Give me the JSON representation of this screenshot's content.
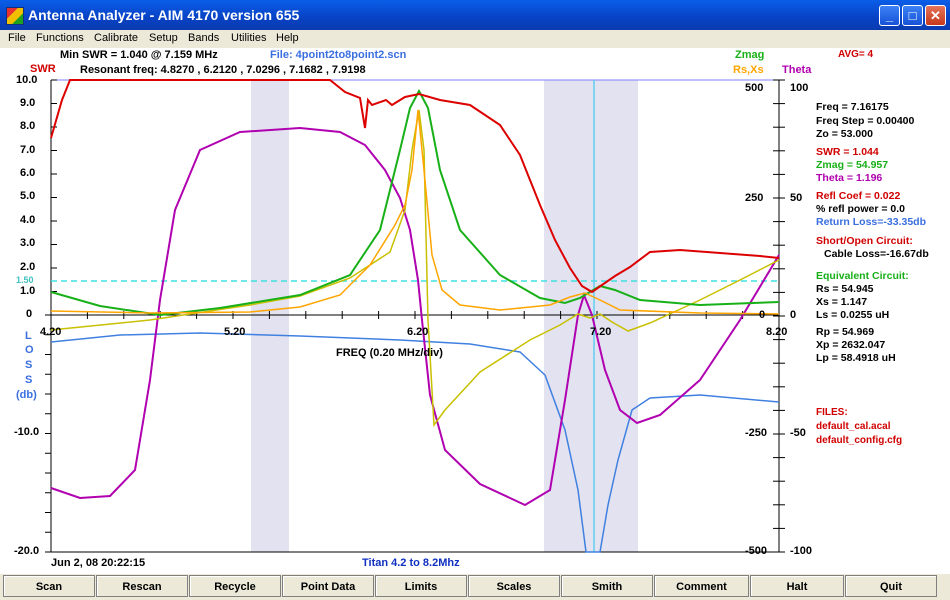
{
  "window": {
    "title": "Antenna Analyzer -   AIM 4170 version 655"
  },
  "menu": [
    "File",
    "Functions",
    "Calibrate",
    "Setup",
    "Bands",
    "Utilities",
    "Help"
  ],
  "header": {
    "min_swr": "Min SWR =  1.040 @  7.159 MHz",
    "file": "File: 4point2to8point2.scn",
    "resonant": "Resonant freq:  4.8270 , 6.2120 , 7.0296 , 7.1682 , 7.9198",
    "avg": "AVG=  4",
    "zmag_label": "Zmag",
    "rsxs_label": "Rs,Xs",
    "theta_label": "Theta",
    "swr_label": "SWR"
  },
  "axes": {
    "swr_ticks": [
      "10.0",
      "9.0",
      "8.0",
      "7.0",
      "6.0",
      "5.0",
      "4.0",
      "3.0",
      "2.0",
      "1.50",
      "1.0",
      "0"
    ],
    "x_ticks": [
      "4.20",
      "5.20",
      "6.20",
      "7.20",
      "8.20"
    ],
    "freq_label": "FREQ (0.20 MHz/div)",
    "loss_label": [
      "L",
      "O",
      "S",
      "S",
      "(db)"
    ],
    "loss_ticks": [
      "-10.0",
      "-20.0"
    ],
    "right1_ticks": [
      "500",
      "250",
      "0",
      "-250",
      "-500"
    ],
    "right2_ticks": [
      "100",
      "50",
      "0",
      "-50",
      "-100"
    ],
    "date": "Jun 2, 08   20:22:15",
    "scan_name": "Titan 4.2 to 8.2Mhz"
  },
  "readout": {
    "freq": "Freq =  7.16175",
    "freq_step": "Freq Step =  0.00400",
    "zo": "Zo =  53.000",
    "swr": "SWR   =   1.044",
    "zmag": "Zmag  =   54.957",
    "theta": "Theta  =    1.196",
    "refl_coef": "Refl Coef    = 0.022",
    "refl_power": "% refl power =  0.0",
    "return_loss": "Return Loss=-33.35db",
    "short_open": "Short/Open Circuit:",
    "cable_loss": "Cable Loss=-16.67db",
    "equiv": "Equivalent Circuit:",
    "rs": "Rs  =  54.945",
    "xs": "Xs  =    1.147",
    "ls": "Ls  =    0.0255  uH",
    "rp": "Rp  =  54.969",
    "xp": "Xp  = 2632.047",
    "lp": "Lp  =   58.4918  uH",
    "files": "FILES:",
    "cal_file": "default_cal.acal",
    "config_file": "default_config.cfg"
  },
  "buttons": [
    "Scan",
    "Rescan",
    "Recycle",
    "Point Data",
    "Limits",
    "Scales",
    "Smith",
    "Comment",
    "Halt",
    "Quit"
  ],
  "colors": {
    "swr": "#dd0000",
    "zmag": "#18b018",
    "rsxs": "#ffa500",
    "theta": "#b000b0",
    "xs": "#c8c000",
    "loss": "#4080e0",
    "cursor": "#60d0f0",
    "band": "#e2e2f0"
  }
}
